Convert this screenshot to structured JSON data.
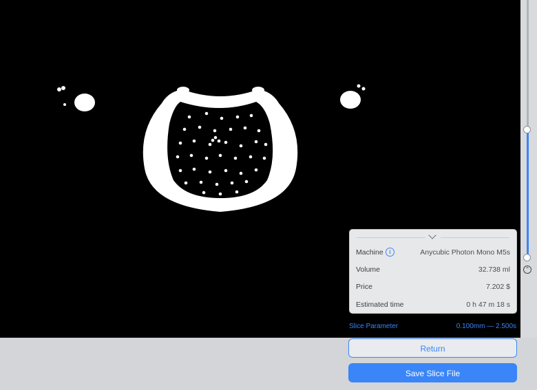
{
  "info_panel": {
    "machine_label": "Machine",
    "machine_value": "Anycubic Photon Mono M5s",
    "volume_label": "Volume",
    "volume_value": "32.738 ml",
    "price_label": "Price",
    "price_value": "7.202 $",
    "time_label": "Estimated time",
    "time_value": "0 h 47 m 18 s"
  },
  "slice_parameter": {
    "label": "Slice Parameter",
    "value": "0.100mm — 2.500s"
  },
  "buttons": {
    "return_label": "Return",
    "save_label": "Save Slice File"
  },
  "colors": {
    "accent": "#3a85f7",
    "viewport_bg": "#000000",
    "panel_bg": "#e7e8ea"
  }
}
